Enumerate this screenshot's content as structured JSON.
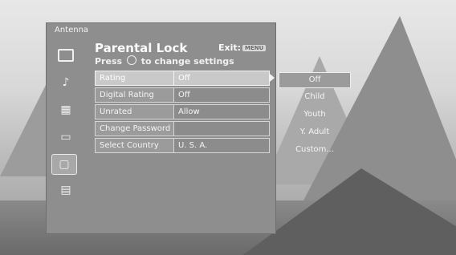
{
  "window": {
    "title": "Antenna"
  },
  "sidebar": {
    "icons": [
      {
        "name": "picture-icon",
        "glyph": "▣"
      },
      {
        "name": "music-note-icon",
        "glyph": "♪"
      },
      {
        "name": "channel-grid-icon",
        "glyph": "▦"
      },
      {
        "name": "tv-icon",
        "glyph": "▭"
      },
      {
        "name": "lock-icon",
        "glyph": "▢"
      },
      {
        "name": "setup-icon",
        "glyph": "▤"
      }
    ]
  },
  "header": {
    "title": "Parental Lock",
    "subtitle_prefix": "Press",
    "subtitle_suffix": "to change settings",
    "exit_label": "Exit:",
    "exit_key": "MENU"
  },
  "settings": [
    {
      "label": "Rating",
      "value": "Off"
    },
    {
      "label": "Digital Rating",
      "value": "Off"
    },
    {
      "label": "Unrated",
      "value": "Allow"
    },
    {
      "label": "Change Password",
      "value": ""
    },
    {
      "label": "Select Country",
      "value": "U. S. A."
    }
  ],
  "rating_options": [
    "Off",
    "Child",
    "Youth",
    "Y. Adult",
    "Custom..."
  ],
  "colors": {
    "panel": "#8e8e8e",
    "highlight": "#c9c9c9",
    "text": "#f5f5f5"
  }
}
